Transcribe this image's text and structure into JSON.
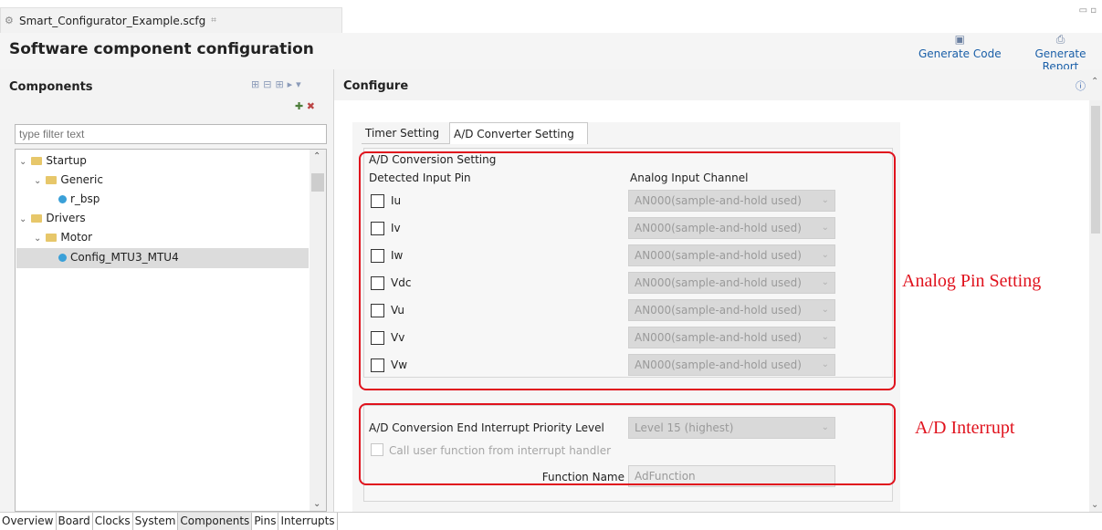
{
  "editor": {
    "tab_title": "Smart_Configurator_Example.scfg",
    "tab_close": "⌗"
  },
  "header": {
    "title": "Software component configuration",
    "generate_code": "Generate Code",
    "generate_report": "Generate Report"
  },
  "components": {
    "title": "Components",
    "filter_placeholder": "type filter text",
    "tree": [
      {
        "label": "Startup",
        "level": 0,
        "kind": "folder",
        "expanded": true
      },
      {
        "label": "Generic",
        "level": 1,
        "kind": "folder",
        "expanded": true
      },
      {
        "label": "r_bsp",
        "level": 2,
        "kind": "component"
      },
      {
        "label": "Drivers",
        "level": 0,
        "kind": "folder",
        "expanded": true
      },
      {
        "label": "Motor",
        "level": 1,
        "kind": "folder",
        "expanded": true
      },
      {
        "label": "Config_MTU3_MTU4",
        "level": 2,
        "kind": "component",
        "selected": true
      }
    ]
  },
  "configure": {
    "title": "Configure",
    "tabs": [
      "Timer Setting",
      "A/D Converter Setting"
    ],
    "active_tab": "A/D Converter Setting",
    "group_title": "A/D Conversion Setting",
    "col_pin": "Detected Input Pin",
    "col_channel": "Analog Input Channel",
    "pins": [
      {
        "label": "Iu",
        "channel": "AN000(sample-and-hold used)",
        "checked": false
      },
      {
        "label": "Iv",
        "channel": "AN000(sample-and-hold used)",
        "checked": false
      },
      {
        "label": "Iw",
        "channel": "AN000(sample-and-hold used)",
        "checked": false
      },
      {
        "label": "Vdc",
        "channel": "AN000(sample-and-hold used)",
        "checked": false
      },
      {
        "label": "Vu",
        "channel": "AN000(sample-and-hold used)",
        "checked": false
      },
      {
        "label": "Vv",
        "channel": "AN000(sample-and-hold used)",
        "checked": false
      },
      {
        "label": "Vw",
        "channel": "AN000(sample-and-hold used)",
        "checked": false
      }
    ],
    "interrupt_label": "A/D Conversion End Interrupt Priority Level",
    "interrupt_value": "Level 15 (highest)",
    "callback_label": "Call user function from interrupt handler",
    "function_name_label": "Function Name",
    "function_name_value": "AdFunction"
  },
  "annotations": {
    "pins": "Analog Pin Setting",
    "interrupt": "A/D Interrupt",
    "color": "#e0121d"
  },
  "bottom_tabs": [
    "Overview",
    "Board",
    "Clocks",
    "System",
    "Components",
    "Pins",
    "Interrupts"
  ],
  "bottom_active": "Components"
}
